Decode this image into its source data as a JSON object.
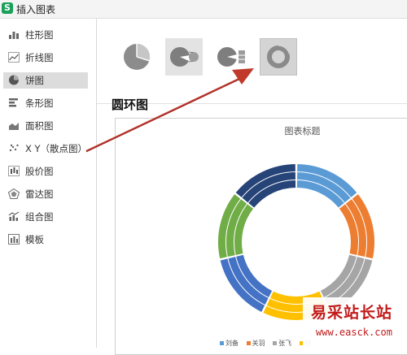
{
  "window": {
    "title": "插入图表",
    "app_icon": "S"
  },
  "sidebar": {
    "items": [
      {
        "label": "柱形图",
        "icon": "column-chart-icon"
      },
      {
        "label": "折线图",
        "icon": "line-chart-icon"
      },
      {
        "label": "饼图",
        "icon": "pie-chart-icon",
        "selected": true
      },
      {
        "label": "条形图",
        "icon": "bar-chart-icon"
      },
      {
        "label": "面积图",
        "icon": "area-chart-icon"
      },
      {
        "label": "X Y（散点图）",
        "icon": "scatter-chart-icon"
      },
      {
        "label": "股价图",
        "icon": "stock-chart-icon"
      },
      {
        "label": "雷达图",
        "icon": "radar-chart-icon"
      },
      {
        "label": "组合图",
        "icon": "combo-chart-icon"
      },
      {
        "label": "模板",
        "icon": "template-icon"
      }
    ]
  },
  "subtypes": [
    {
      "icon": "pie-subtype-icon"
    },
    {
      "icon": "pie-of-pie-subtype-icon"
    },
    {
      "icon": "bar-of-pie-subtype-icon"
    },
    {
      "icon": "doughnut-subtype-icon",
      "selected": true
    }
  ],
  "section_title": "圆环图",
  "chart_data": {
    "type": "doughnut",
    "title": "图表标题",
    "categories": [
      "刘备",
      "关羽",
      "张飞",
      "赵"
    ],
    "colors": [
      "#5b9bd5",
      "#ed7d31",
      "#a5a5a5",
      "#ffc000",
      "#4472c4",
      "#70ad47",
      "#264478"
    ],
    "series": [
      {
        "values": [
          1,
          1,
          1,
          1,
          1,
          1,
          1
        ]
      },
      {
        "values": [
          1,
          1,
          1,
          1,
          1,
          1,
          1
        ]
      },
      {
        "values": [
          1,
          1,
          1,
          1,
          1,
          1,
          1
        ]
      }
    ]
  },
  "watermark": {
    "main": "易采站长站",
    "url": "www.easck.com"
  }
}
